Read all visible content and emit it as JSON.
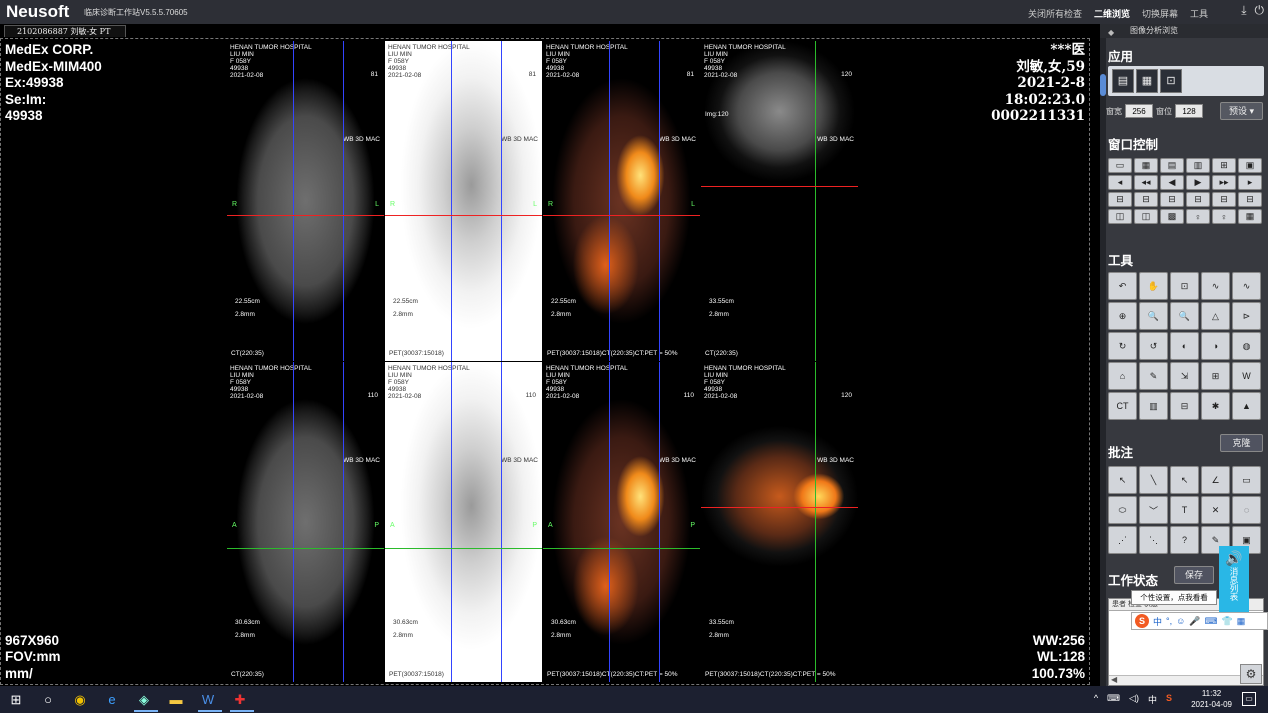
{
  "titlebar": {
    "logo": "Neusoft",
    "app_title": "临床诊断工作站V5.5.5.70605",
    "menu": [
      "关闭所有检查",
      "二维浏览",
      "切换屏幕",
      "工具"
    ],
    "active_menu": "二维浏览"
  },
  "study_tab": "2102086887 刘敏-女 PT",
  "overlay": {
    "tl": [
      "MedEx CORP.",
      "MedEx-MIM400",
      "Ex:49938",
      "Se:Im:",
      "49938"
    ],
    "tr": [
      "***医",
      "刘敏,女,59",
      "2021-2-8",
      "18:02:23.0",
      "0002211331"
    ],
    "bl": [
      "967X960",
      "FOV:mm",
      "mm/"
    ],
    "br": [
      "WW:256",
      "WL:128",
      "100.73%"
    ]
  },
  "tile_header": [
    "HENAN TUMOR HOSPITAL",
    "LIU MIN",
    "F  058Y",
    "49938",
    "2021-02-08"
  ],
  "tiles": [
    {
      "kind": "ct",
      "num": "81",
      "wb": "WB 3D MAC",
      "dist": "22.55cm",
      "thk": "2.8mm",
      "foot": "CT(220:35)",
      "left": "R",
      "right": "L"
    },
    {
      "kind": "pet",
      "num": "81",
      "wb": "WB 3D MAC",
      "dist": "22.55cm",
      "thk": "2.8mm",
      "foot": "PET(30037:15018)",
      "left": "R",
      "right": "L"
    },
    {
      "kind": "fus",
      "num": "81",
      "wb": "WB 3D MAC",
      "dist": "22.55cm",
      "thk": "2.8mm",
      "foot": "PET(30037:15018)CT(220:35)CT:PET = 50%",
      "left": "R",
      "right": "L"
    },
    {
      "kind": "ax",
      "num": "120",
      "wb": "WB 3D MAC",
      "img": "Img:120",
      "dist": "33.55cm",
      "thk": "2.8mm",
      "foot": "CT(220:35)",
      "left": "",
      "right": ""
    },
    {
      "kind": "ct",
      "num": "110",
      "wb": "WB 3D MAC",
      "dist": "30.63cm",
      "thk": "2.8mm",
      "foot": "CT(220:35)",
      "left": "A",
      "right": "P"
    },
    {
      "kind": "pet",
      "num": "110",
      "wb": "WB 3D MAC",
      "dist": "30.63cm",
      "thk": "2.8mm",
      "foot": "PET(30037:15018)",
      "left": "A",
      "right": "P"
    },
    {
      "kind": "fus",
      "num": "110",
      "wb": "WB 3D MAC",
      "dist": "30.63cm",
      "thk": "2.8mm",
      "foot": "PET(30037:15018)CT(220:35)CT:PET = 50%",
      "left": "A",
      "right": "P"
    },
    {
      "kind": "axfus",
      "num": "120",
      "wb": "WB 3D MAC",
      "dist": "33.55cm",
      "thk": "2.8mm",
      "foot": "PET(30037:15018)CT(220:35)CT:PET = 50%",
      "left": "",
      "right": ""
    }
  ],
  "panel": {
    "tab": "图像分析浏览",
    "sections": {
      "apply": "应用",
      "window": "窗口控制",
      "tools": "工具",
      "annot": "批注",
      "work": "工作状态"
    },
    "ww_label": "窗宽",
    "ww": "256",
    "wl_label": "窗位",
    "wl": "128",
    "preset": "预设",
    "clone": "克隆",
    "save": "保存",
    "worklist_head": "患者    检查    状态"
  },
  "tooltip": "个性设置，点我看看",
  "msg_tab": "消息列表",
  "ime": [
    "中",
    "°,",
    "☺",
    "🎤",
    "⌨",
    "👕",
    "▦"
  ],
  "clock": {
    "time": "11:32",
    "date": "2021-04-09"
  },
  "tray": [
    "^",
    "中",
    "S"
  ]
}
